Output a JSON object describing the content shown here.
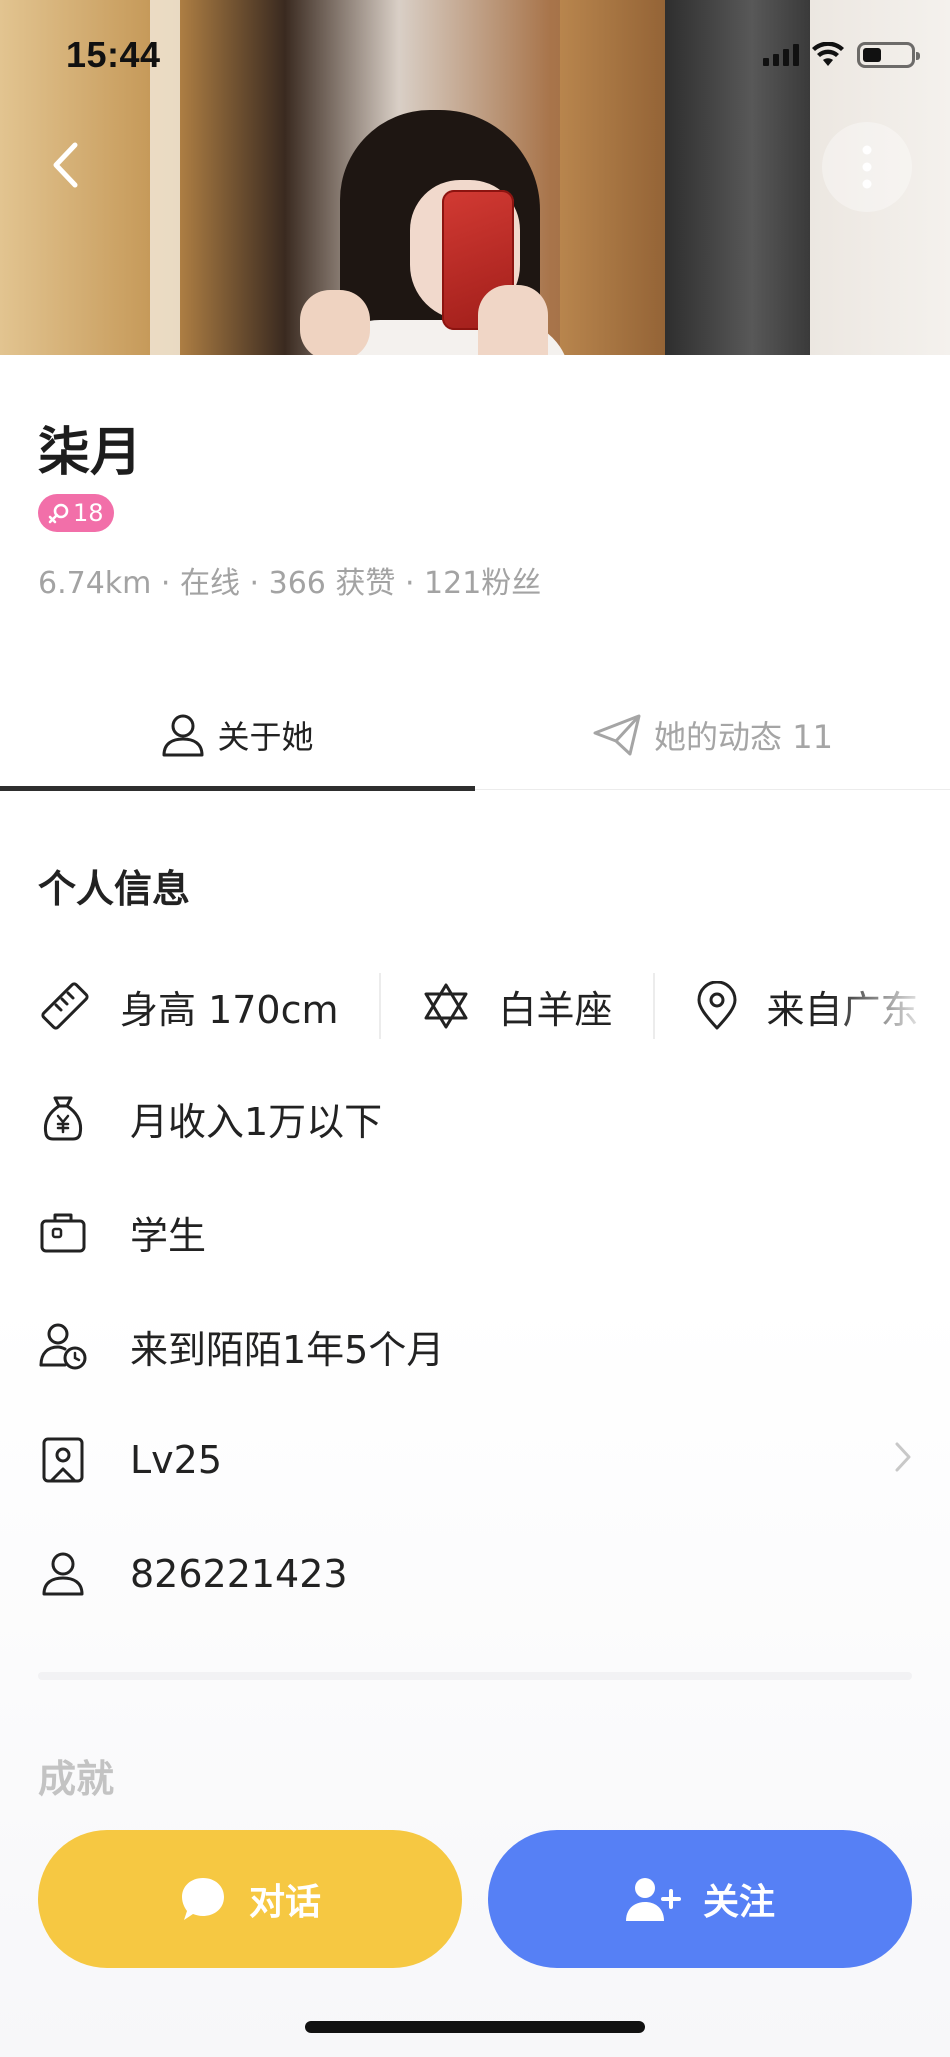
{
  "status_bar": {
    "time": "15:44"
  },
  "profile": {
    "name": "柒月",
    "age": "18",
    "meta": "6.74km · 在线 · 366 获赞 · 121粉丝"
  },
  "tabs": [
    {
      "label": "关于她",
      "active": true,
      "icon": "person-icon"
    },
    {
      "label": "她的动态 11",
      "active": false,
      "icon": "paper-plane-icon"
    }
  ],
  "personal_info": {
    "title": "个人信息",
    "chips": [
      {
        "label": "身高 170cm",
        "icon": "ruler-icon"
      },
      {
        "label": "白羊座",
        "icon": "star-of-david-icon"
      },
      {
        "label": "来自广东",
        "icon": "location-pin-icon"
      }
    ],
    "rows": [
      {
        "label": "月收入1万以下",
        "icon": "money-bag-icon"
      },
      {
        "label": "学生",
        "icon": "briefcase-icon"
      },
      {
        "label": "来到陌陌1年5个月",
        "icon": "user-clock-icon"
      },
      {
        "label": "Lv25",
        "icon": "level-badge-icon",
        "has_chevron": true
      },
      {
        "label": "826221423",
        "icon": "user-icon"
      }
    ]
  },
  "achievements": {
    "title": "成就"
  },
  "actions": {
    "chat_label": "对话",
    "follow_label": "关注"
  },
  "colors": {
    "chat_button": "#f6c842",
    "follow_button": "#5680f5",
    "age_badge": "#f26fa9",
    "meta_text": "#a3a3a3"
  }
}
